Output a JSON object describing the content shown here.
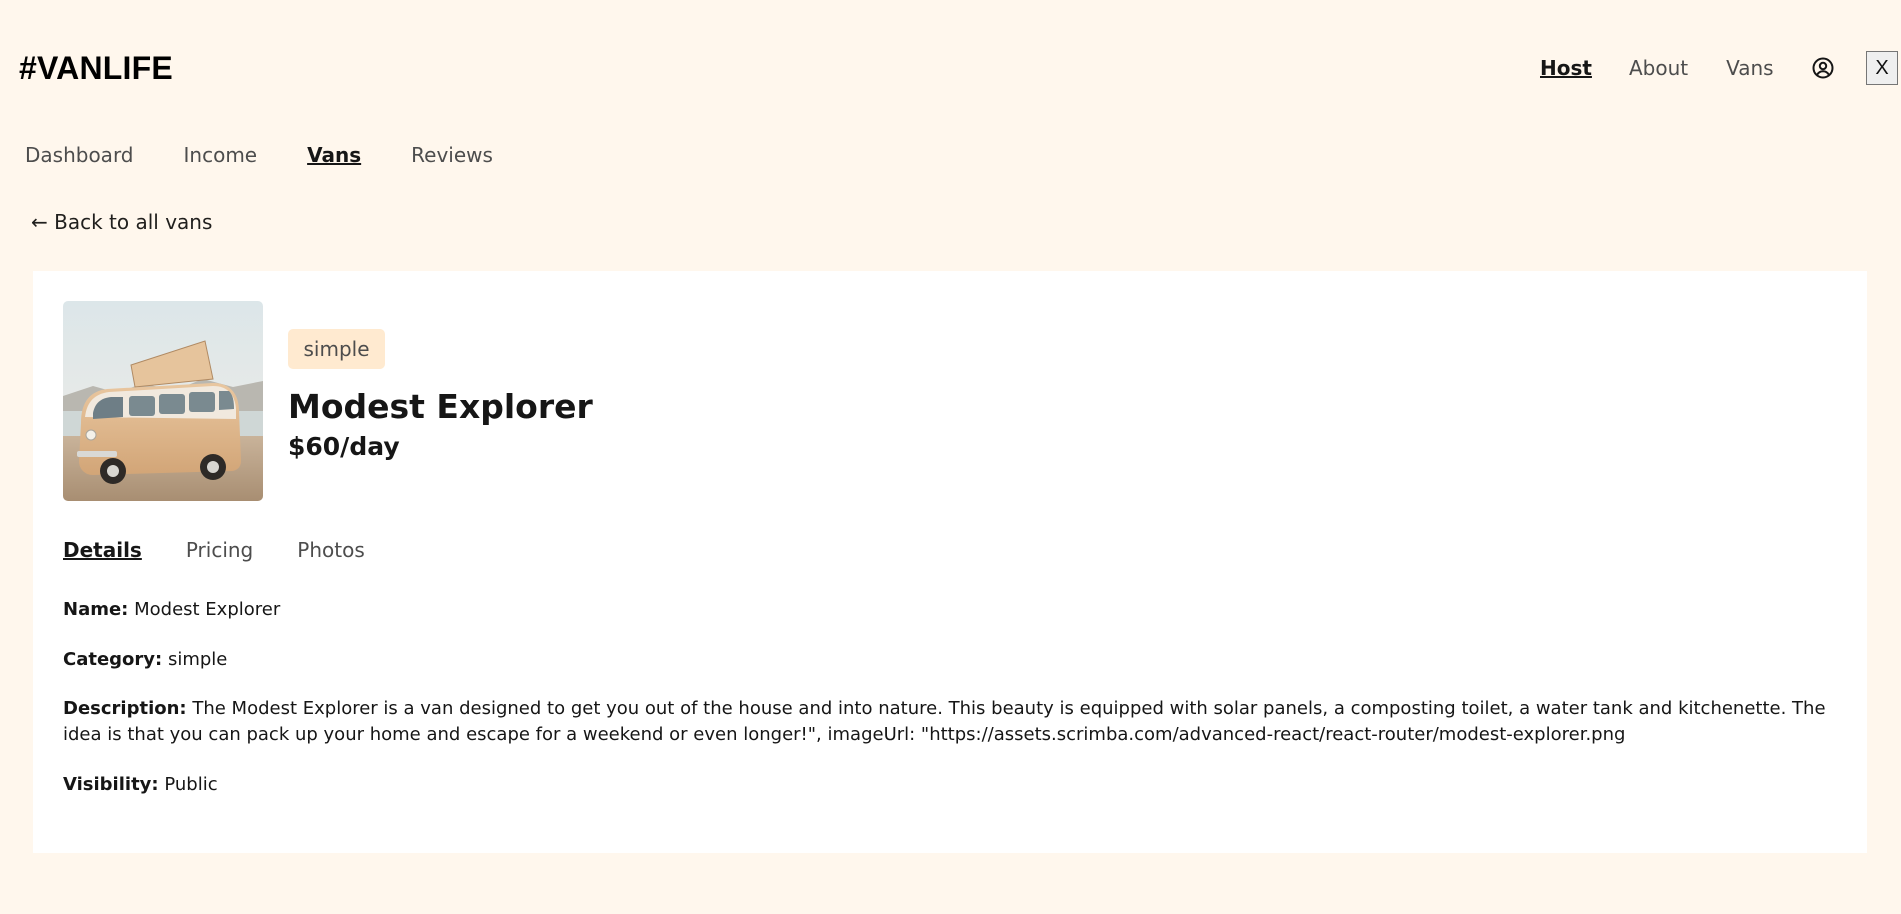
{
  "header": {
    "logo": "#VANLIFE",
    "nav": {
      "host": "Host",
      "about": "About",
      "vans": "Vans"
    },
    "logout_label": "X"
  },
  "host_nav": {
    "dashboard": "Dashboard",
    "income": "Income",
    "vans": "Vans",
    "reviews": "Reviews",
    "active": "Vans"
  },
  "back_link": "← Back to all vans",
  "van": {
    "type": "simple",
    "name": "Modest Explorer",
    "price": "$60/day"
  },
  "detail_tabs": {
    "details": "Details",
    "pricing": "Pricing",
    "photos": "Photos",
    "active": "Details"
  },
  "details": {
    "name_label": "Name:",
    "name_value": "Modest Explorer",
    "category_label": "Category:",
    "category_value": "simple",
    "description_label": "Description:",
    "description_value": "The Modest Explorer is a van designed to get you out of the house and into nature. This beauty is equipped with solar panels, a composting toilet, a water tank and kitchenette. The idea is that you can pack up your home and escape for a weekend or even longer!\", imageUrl: \"https://assets.scrimba.com/advanced-react/react-router/modest-explorer.png",
    "visibility_label": "Visibility:",
    "visibility_value": "Public"
  },
  "icons": {
    "user": "user-circle-icon"
  },
  "colors": {
    "page_background": "#FFF7ED",
    "card_background": "#FFFFFF",
    "badge_background": "#FFEAD0",
    "text_primary": "#161616",
    "text_muted": "#4D4D4D"
  }
}
